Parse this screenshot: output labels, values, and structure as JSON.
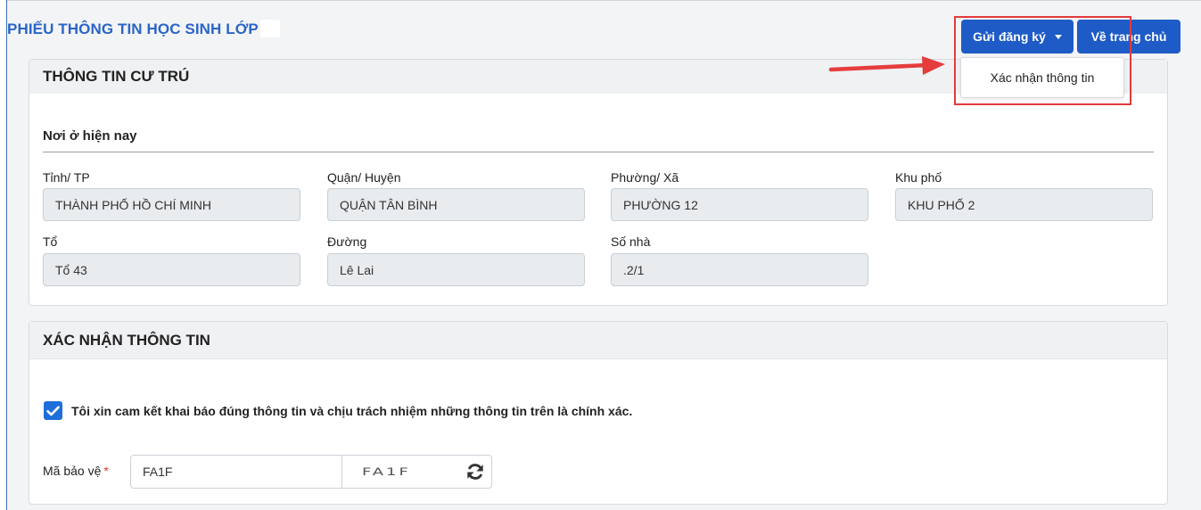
{
  "header": {
    "title": "PHIẾU THÔNG TIN HỌC SINH LỚP",
    "send_button": "Gửi đăng ký",
    "home_button": "Về trang chủ",
    "dropdown_item": "Xác nhận thông tin"
  },
  "residence": {
    "heading": "THÔNG TIN CƯ TRÚ",
    "subheading": "Nơi ở hiện nay",
    "fields": [
      {
        "label": "Tỉnh/ TP",
        "value": "THÀNH PHỐ HỒ CHÍ MINH"
      },
      {
        "label": "Quận/ Huyện",
        "value": "QUẬN TÂN BÌNH"
      },
      {
        "label": "Phường/ Xã",
        "value": "PHƯỜNG 12"
      },
      {
        "label": "Khu phố",
        "value": "KHU PHỐ 2"
      },
      {
        "label": "Tổ",
        "value": "Tổ 43"
      },
      {
        "label": "Đường",
        "value": "Lê Lai"
      },
      {
        "label": "Số nhà",
        "value": ".2/1"
      }
    ]
  },
  "confirm": {
    "heading": "XÁC NHẬN THÔNG TIN",
    "checkbox_text": "Tôi xin cam kết khai báo đúng thông tin và chịu trách nhiệm những thông tin trên là chính xác.",
    "checkbox_checked": true,
    "captcha_label": "Mã bảo vệ",
    "required_mark": "*",
    "captcha_value": "FA1F",
    "captcha_image_text": "FA1F"
  },
  "colors": {
    "accent": "#1e5bc6",
    "highlight": "#e33b3b",
    "checkbox": "#1e6fd9"
  },
  "icons": [
    "caret-down-icon",
    "check-icon",
    "refresh-icon",
    "arrow-annotation-icon"
  ]
}
